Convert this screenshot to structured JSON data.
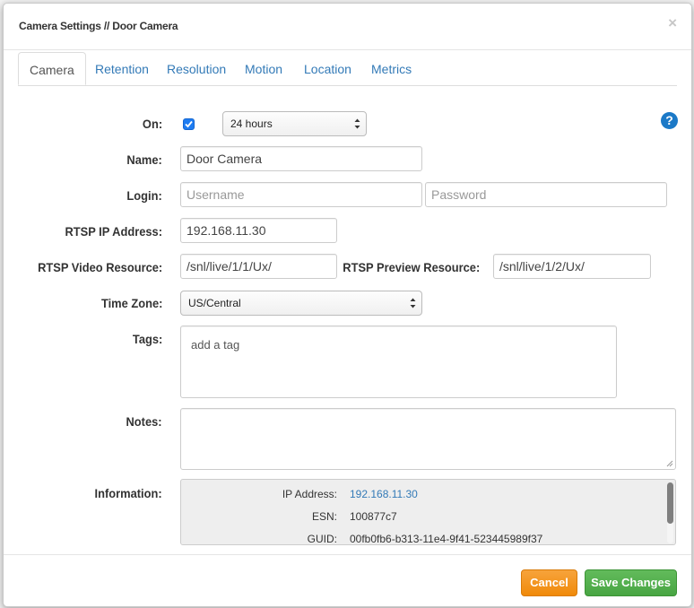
{
  "modal": {
    "title": "Camera Settings // Door Camera",
    "close": "×"
  },
  "tabs": [
    "Camera",
    "Retention",
    "Resolution",
    "Motion",
    "Location",
    "Metrics"
  ],
  "form": {
    "on_label": "On:",
    "on_checked": true,
    "on_schedule": "24 hours",
    "name_label": "Name:",
    "name_value": "Door Camera",
    "login_label": "Login:",
    "username_placeholder": "Username",
    "password_placeholder": "Password",
    "rtsp_ip_label": "RTSP IP Address:",
    "rtsp_ip_value": "192.168.11.30",
    "rtsp_video_label": "RTSP Video Resource:",
    "rtsp_video_value": "/snl/live/1/1/Ux/",
    "rtsp_preview_label": "RTSP Preview Resource:",
    "rtsp_preview_value": "/snl/live/1/2/Ux/",
    "timezone_label": "Time Zone:",
    "timezone_value": "US/Central",
    "tags_label": "Tags:",
    "tags_placeholder": "add a tag",
    "notes_label": "Notes:",
    "information_label": "Information:"
  },
  "information": {
    "ip_label": "IP Address:",
    "ip_value": "192.168.11.30",
    "esn_label": "ESN:",
    "esn_value": "100877c7",
    "guid_label": "GUID:",
    "guid_value": "00fb0fb6-b313-11e4-9f41-523445989f37"
  },
  "help": "?",
  "footer": {
    "cancel": "Cancel",
    "save": "Save Changes"
  },
  "colors": {
    "link": "#337ab7",
    "cancel": "#f08a0a",
    "save": "#48a543",
    "help": "#1b79c7"
  }
}
